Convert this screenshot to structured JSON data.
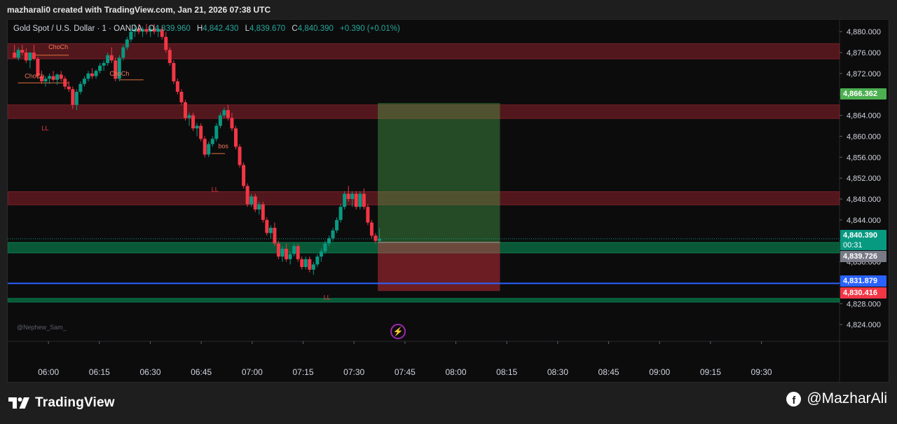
{
  "caption": "mazharali0 created with TradingView.com, Jan 21, 2026 07:38 UTC",
  "symbol": {
    "name": "Gold Spot / U.S. Dollar · 1 · OANDA",
    "o_label": "O",
    "o_value": "4,839.960",
    "h_label": "H",
    "h_value": "4,842.430",
    "l_label": "L",
    "l_value": "4,839.670",
    "c_label": "C",
    "c_value": "4,840.390",
    "change": "+0.390 (+0.01%)"
  },
  "watermark_author": "@Nephew_Sam_",
  "price_tags": {
    "target": "4,866.362",
    "current": "4,840.390",
    "countdown": "00:31",
    "entry": "4,839.726",
    "blue_line": "4,831.879",
    "stop": "4,830.416"
  },
  "footer": {
    "brand": "TradingView",
    "handle": "@MazharAli",
    "brand_icon": "tradingview-logo-icon",
    "handle_icon": "facebook-icon"
  },
  "chart_data": {
    "type": "candlestick",
    "symbol": "Gold Spot / U.S. Dollar",
    "timeframe": "1",
    "y_ticks": [
      "4,880.000",
      "4,876.000",
      "4,872.000",
      "4,868.000",
      "4,864.000",
      "4,860.000",
      "4,856.000",
      "4,852.000",
      "4,848.000",
      "4,844.000",
      "4,840.000",
      "4,836.000",
      "4,832.000",
      "4,828.000",
      "4,824.000"
    ],
    "y_tick_values": [
      4880,
      4876,
      4872,
      4868,
      4864,
      4860,
      4856,
      4852,
      4848,
      4844,
      4840,
      4836,
      4832,
      4828,
      4824
    ],
    "ylim": [
      4820.8,
      4882.3
    ],
    "x_ticks": [
      "06:00",
      "06:15",
      "06:30",
      "06:45",
      "07:00",
      "07:15",
      "07:30",
      "07:45",
      "08:00",
      "08:15",
      "08:30",
      "08:45",
      "09:00",
      "09:15",
      "09:30"
    ],
    "x_start_minute": 348,
    "x_end_minute": 593,
    "zones": [
      {
        "kind": "supply",
        "low": 4874.8,
        "high": 4877.7,
        "start_minute": 348,
        "end_minute": 593
      },
      {
        "kind": "supply",
        "low": 4863.4,
        "high": 4866.0,
        "start_minute": 348,
        "end_minute": 593
      },
      {
        "kind": "supply",
        "low": 4846.9,
        "high": 4849.4,
        "start_minute": 348,
        "end_minute": 593
      },
      {
        "kind": "demand",
        "low": 4837.7,
        "high": 4839.7,
        "start_minute": 348,
        "end_minute": 593
      },
      {
        "kind": "demand",
        "low": 4828.3,
        "high": 4829.0,
        "start_minute": 348,
        "end_minute": 593
      }
    ],
    "position": {
      "entry": 4839.726,
      "target": 4866.362,
      "stop": 4830.416,
      "start_minute": 457,
      "end_minute": 493
    },
    "horizontal_lines": [
      {
        "value": 4831.879,
        "color": "#2962ff"
      }
    ],
    "current_price": 4840.39,
    "labels": [
      {
        "text": "ChoCh",
        "minute": 360,
        "price": 4876.7
      },
      {
        "text": "ChoCh",
        "minute": 353,
        "price": 4871.1
      },
      {
        "text": "ChoCh",
        "minute": 378,
        "price": 4871.6
      },
      {
        "text": "bos",
        "minute": 410,
        "price": 4857.7
      },
      {
        "text": "LL",
        "minute": 358,
        "price": 4861.1
      },
      {
        "text": "LL",
        "minute": 408,
        "price": 4849.4
      },
      {
        "text": "LL",
        "minute": 441,
        "price": 4828.8
      }
    ],
    "structure_lines": [
      {
        "from_minute": 356,
        "to_minute": 366,
        "price": 4875.5
      },
      {
        "from_minute": 351,
        "to_minute": 366,
        "price": 4870.2
      },
      {
        "from_minute": 381,
        "to_minute": 388,
        "price": 4870.8
      },
      {
        "from_minute": 408,
        "to_minute": 412,
        "price": 4856.7
      }
    ],
    "candles": [
      [
        4876.0,
        4877.5,
        4875.5,
        4875.0
      ],
      [
        4875.0,
        4877.0,
        4874.5,
        4876.5
      ],
      [
        4876.5,
        4877.5,
        4875.5,
        4876.0
      ],
      [
        4876.0,
        4876.8,
        4874.0,
        4874.5
      ],
      [
        4874.5,
        4875.5,
        4873.0,
        4876.0
      ],
      [
        4876.0,
        4877.5,
        4874.5,
        4874.8
      ],
      [
        4874.8,
        4875.2,
        4871.0,
        4871.5
      ],
      [
        4871.5,
        4872.5,
        4870.0,
        4870.5
      ],
      [
        4870.5,
        4871.5,
        4869.5,
        4871.0
      ],
      [
        4871.0,
        4872.0,
        4870.0,
        4871.5
      ],
      [
        4871.5,
        4872.5,
        4870.5,
        4870.8
      ],
      [
        4870.8,
        4872.0,
        4869.8,
        4871.8
      ],
      [
        4871.8,
        4872.5,
        4870.5,
        4871.0
      ],
      [
        4871.0,
        4871.5,
        4869.0,
        4869.5
      ],
      [
        4869.5,
        4870.5,
        4868.5,
        4869.0
      ],
      [
        4869.0,
        4869.5,
        4865.2,
        4866.0
      ],
      [
        4866.0,
        4869.0,
        4865.0,
        4868.5
      ],
      [
        4868.5,
        4870.5,
        4868.0,
        4870.0
      ],
      [
        4870.0,
        4871.5,
        4869.5,
        4871.0
      ],
      [
        4871.0,
        4872.5,
        4870.5,
        4872.0
      ],
      [
        4872.0,
        4873.0,
        4871.0,
        4871.5
      ],
      [
        4871.5,
        4872.8,
        4871.0,
        4872.5
      ],
      [
        4872.5,
        4874.0,
        4872.0,
        4873.5
      ],
      [
        4873.5,
        4874.5,
        4872.5,
        4874.0
      ],
      [
        4874.0,
        4876.0,
        4873.5,
        4875.5
      ],
      [
        4875.5,
        4877.0,
        4874.0,
        4874.5
      ],
      [
        4874.5,
        4875.0,
        4870.5,
        4871.0
      ],
      [
        4871.0,
        4875.5,
        4870.5,
        4875.0
      ],
      [
        4875.0,
        4877.5,
        4874.5,
        4877.0
      ],
      [
        4877.0,
        4879.0,
        4876.5,
        4878.5
      ],
      [
        4878.5,
        4880.5,
        4878.0,
        4880.0
      ],
      [
        4880.0,
        4881.5,
        4879.0,
        4880.5
      ],
      [
        4880.5,
        4881.5,
        4879.5,
        4880.0
      ],
      [
        4880.0,
        4881.0,
        4879.0,
        4880.5
      ],
      [
        4880.5,
        4881.5,
        4879.5,
        4880.0
      ],
      [
        4880.0,
        4881.0,
        4879.0,
        4880.5
      ],
      [
        4880.5,
        4881.5,
        4879.5,
        4880.0
      ],
      [
        4880.0,
        4881.2,
        4879.0,
        4880.5
      ],
      [
        4880.5,
        4881.2,
        4878.5,
        4879.0
      ],
      [
        4879.0,
        4880.0,
        4876.0,
        4876.5
      ],
      [
        4876.5,
        4877.0,
        4873.5,
        4874.0
      ],
      [
        4874.0,
        4874.5,
        4870.0,
        4870.5
      ],
      [
        4870.5,
        4871.0,
        4868.0,
        4868.5
      ],
      [
        4868.5,
        4869.0,
        4866.0,
        4866.5
      ],
      [
        4866.5,
        4867.0,
        4863.0,
        4863.5
      ],
      [
        4863.5,
        4864.5,
        4862.0,
        4864.0
      ],
      [
        4864.0,
        4864.5,
        4861.0,
        4861.5
      ],
      [
        4861.5,
        4862.5,
        4860.0,
        4862.0
      ],
      [
        4862.0,
        4862.5,
        4859.0,
        4859.5
      ],
      [
        4859.5,
        4860.0,
        4856.0,
        4856.5
      ],
      [
        4856.5,
        4859.0,
        4856.0,
        4858.5
      ],
      [
        4858.5,
        4860.0,
        4858.0,
        4859.5
      ],
      [
        4859.5,
        4862.5,
        4859.0,
        4862.0
      ],
      [
        4862.0,
        4864.5,
        4861.5,
        4864.0
      ],
      [
        4864.0,
        4865.5,
        4863.5,
        4865.0
      ],
      [
        4865.0,
        4866.0,
        4863.0,
        4863.5
      ],
      [
        4863.5,
        4864.5,
        4861.0,
        4861.5
      ],
      [
        4861.5,
        4862.0,
        4857.5,
        4858.0
      ],
      [
        4858.0,
        4858.5,
        4854.0,
        4854.5
      ],
      [
        4854.5,
        4855.0,
        4850.0,
        4850.5
      ],
      [
        4850.5,
        4851.0,
        4846.5,
        4847.0
      ],
      [
        4847.0,
        4849.0,
        4846.5,
        4848.5
      ],
      [
        4848.5,
        4849.0,
        4845.5,
        4846.0
      ],
      [
        4846.0,
        4847.5,
        4845.0,
        4847.0
      ],
      [
        4847.0,
        4847.5,
        4843.5,
        4844.0
      ],
      [
        4844.0,
        4844.5,
        4841.0,
        4841.5
      ],
      [
        4841.5,
        4843.0,
        4840.5,
        4842.5
      ],
      [
        4842.5,
        4843.5,
        4839.0,
        4839.5
      ],
      [
        4839.5,
        4840.0,
        4836.5,
        4837.0
      ],
      [
        4837.0,
        4839.0,
        4836.0,
        4838.5
      ],
      [
        4838.5,
        4839.5,
        4836.0,
        4836.5
      ],
      [
        4836.5,
        4838.0,
        4835.5,
        4837.5
      ],
      [
        4837.5,
        4839.5,
        4837.0,
        4839.0
      ],
      [
        4839.0,
        4839.5,
        4836.0,
        4836.5
      ],
      [
        4836.5,
        4837.0,
        4834.5,
        4835.0
      ],
      [
        4835.0,
        4837.0,
        4834.5,
        4836.5
      ],
      [
        4836.5,
        4837.0,
        4834.0,
        4834.5
      ],
      [
        4834.5,
        4836.0,
        4833.5,
        4835.5
      ],
      [
        4835.5,
        4837.5,
        4835.0,
        4837.0
      ],
      [
        4837.0,
        4838.5,
        4836.0,
        4838.0
      ],
      [
        4838.0,
        4840.0,
        4837.5,
        4839.5
      ],
      [
        4839.5,
        4841.0,
        4839.0,
        4840.5
      ],
      [
        4840.5,
        4842.5,
        4840.0,
        4842.0
      ],
      [
        4842.0,
        4844.5,
        4841.5,
        4844.0
      ],
      [
        4844.0,
        4847.0,
        4843.5,
        4846.5
      ],
      [
        4846.5,
        4849.5,
        4846.0,
        4849.0
      ],
      [
        4849.0,
        4850.5,
        4847.5,
        4848.0
      ],
      [
        4848.0,
        4849.5,
        4846.5,
        4849.0
      ],
      [
        4849.0,
        4849.5,
        4846.0,
        4846.5
      ],
      [
        4846.5,
        4849.5,
        4846.0,
        4849.0
      ],
      [
        4849.0,
        4850.0,
        4846.0,
        4846.5
      ],
      [
        4846.5,
        4847.0,
        4843.0,
        4843.5
      ],
      [
        4843.5,
        4844.0,
        4840.5,
        4841.0
      ],
      [
        4841.0,
        4841.5,
        4839.5,
        4840.0
      ],
      [
        4840.0,
        4842.4,
        4839.7,
        4840.4
      ]
    ]
  }
}
